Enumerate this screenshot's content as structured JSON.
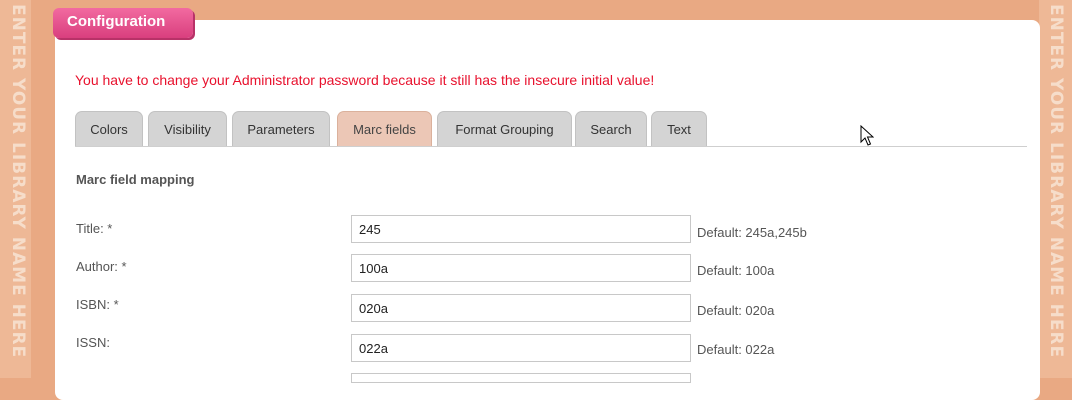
{
  "side_banner": {
    "text": "ENTER YOUR LIBRARY NAME HERE"
  },
  "header": {
    "title": "Configuration"
  },
  "warning": "You have to change your Administrator password because it still has the insecure initial value!",
  "tabs": [
    {
      "label": "Colors",
      "active": false
    },
    {
      "label": "Visibility",
      "active": false
    },
    {
      "label": "Parameters",
      "active": false
    },
    {
      "label": "Marc fields",
      "active": true
    },
    {
      "label": "Format Grouping",
      "active": false
    },
    {
      "label": "Search",
      "active": false
    },
    {
      "label": "Text",
      "active": false
    }
  ],
  "section": {
    "title": "Marc field mapping"
  },
  "fields": [
    {
      "label": "Title: *",
      "value": "245",
      "default": "Default: 245a,245b"
    },
    {
      "label": "Author: *",
      "value": "100a",
      "default": "Default: 100a"
    },
    {
      "label": "ISBN: *",
      "value": "020a",
      "default": "Default: 020a"
    },
    {
      "label": "ISSN:",
      "value": "022a",
      "default": "Default: 022a"
    },
    {
      "label": "",
      "value": "",
      "default": ""
    }
  ],
  "colors": {
    "accent": "#d93f7e",
    "warning": "#e8112d",
    "background": "#e9a983"
  }
}
